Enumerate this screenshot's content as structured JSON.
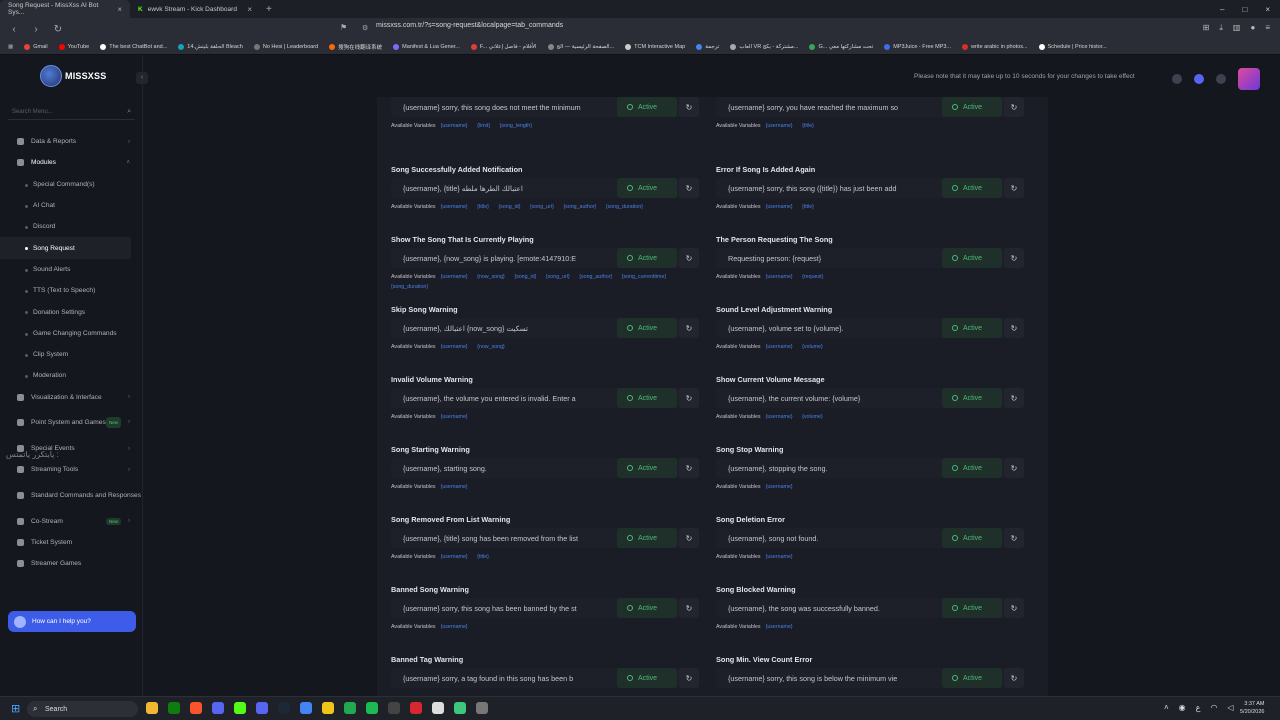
{
  "browser": {
    "tabs": [
      {
        "title": "Song Request - MissXss AI Bot Sys...",
        "active": true
      },
      {
        "title": "ewvk Stream - Kick Dashboard",
        "active": false
      }
    ],
    "url": "missxss.com.tr/?s=song-request&localpage=tab_commands",
    "bookmarks": [
      {
        "label": "Gmail",
        "color": "#ea4335"
      },
      {
        "label": "YouTube",
        "color": "#ff0000"
      },
      {
        "label": "The best ChatBot and...",
        "color": "#ffffff"
      },
      {
        "label": "14.الحلقة بليتش Bleach",
        "color": "#12a3b8"
      },
      {
        "label": "No Hesi | Leaderboard",
        "color": "#777777"
      },
      {
        "label": "搜狗在线翻译系统",
        "color": "#ff6a00"
      },
      {
        "label": "Manifest & Lua Gener...",
        "color": "#7b6cff"
      },
      {
        "label": "F... الأفلام - فاصل إعلاني",
        "color": "#e23b3b"
      },
      {
        "label": "الصفحة الرئيسية — الج...",
        "color": "#888888"
      },
      {
        "label": "TCM Interactive Map",
        "color": "#cccccc"
      },
      {
        "label": "ترجمة",
        "color": "#4285f4"
      },
      {
        "label": "العاب VR مشتركة - بكج...",
        "color": "#aaaaaa"
      },
      {
        "label": "G... تحت مشاركتها معي",
        "color": "#34a853"
      },
      {
        "label": "MP3Juice - Free MP3...",
        "color": "#3d6ee8"
      },
      {
        "label": "write arabic in photos...",
        "color": "#d93025"
      },
      {
        "label": "Schedule | Price histor...",
        "color": "#ffffff"
      }
    ]
  },
  "app": {
    "brand": "MISSXSS",
    "search_placeholder": "Search Menu...",
    "notice": "Please note that it may take up to 10 seconds for your changes to take effect",
    "help_button": "How can I help you?",
    "overlay_text": "يابتكرر ياتمتس :",
    "nav": [
      {
        "label": "Data & Reports",
        "kind": "top",
        "chevron": "›"
      },
      {
        "label": "Modules",
        "kind": "top",
        "chevron": "˄",
        "open": true
      },
      {
        "label": "Special Command(s)",
        "kind": "sub"
      },
      {
        "label": "AI Chat",
        "kind": "sub"
      },
      {
        "label": "Discord",
        "kind": "sub"
      },
      {
        "label": "Song Request",
        "kind": "sub",
        "active": true
      },
      {
        "label": "Sound Alerts",
        "kind": "sub"
      },
      {
        "label": "TTS (Text to Speech)",
        "kind": "sub"
      },
      {
        "label": "Donation Settings",
        "kind": "sub"
      },
      {
        "label": "Game Changing Commands",
        "kind": "sub"
      },
      {
        "label": "Clip System",
        "kind": "sub"
      },
      {
        "label": "Moderation",
        "kind": "sub"
      },
      {
        "label": "Visualization & Interface",
        "kind": "top",
        "chevron": "›"
      },
      {
        "label": "Point System and Games",
        "kind": "top",
        "chevron": "›",
        "badge": "New",
        "two": true
      },
      {
        "label": "Special Events",
        "kind": "top",
        "chevron": "›"
      },
      {
        "label": "Streaming Tools",
        "kind": "top",
        "chevron": "›"
      },
      {
        "label": "Standard Commands and Responses",
        "kind": "top",
        "chevron": "",
        "two": true
      },
      {
        "label": "Co-Stream",
        "kind": "top",
        "chevron": "›",
        "badge": "New"
      },
      {
        "label": "Ticket System",
        "kind": "top",
        "chevron": ""
      },
      {
        "label": "Streamer Games",
        "kind": "top",
        "chevron": ""
      }
    ]
  },
  "commands": {
    "status_label": "Active",
    "vars_label": "Available Variables",
    "left": [
      {
        "title": "",
        "text": "{username} sorry, this song does not meet the minimum",
        "vars": [
          "{username}",
          "{limit}",
          "{song_length}"
        ]
      },
      {
        "title": "Song Successfully Added Notification",
        "text": "{username}, {title} اعتبالك الطرها ملطه",
        "vars": [
          "{username}",
          "{title}",
          "{song_id}",
          "{song_url}",
          "{song_author}",
          "{song_duration}"
        ]
      },
      {
        "title": "Show The Song That Is Currently Playing",
        "text": "{username}, {now_song} is playing. [emote:4147910:E",
        "vars": [
          "{username}",
          "{now_song}",
          "{song_id}",
          "{song_url}",
          "{song_author}",
          "{song_currenttime}",
          "{song_duration}"
        ]
      },
      {
        "title": "Skip Song Warning",
        "text": "{username}, اعتبالك {now_song} تسكيت",
        "vars": [
          "{username}",
          "{now_song}"
        ]
      },
      {
        "title": "Invalid Volume Warning",
        "text": "{username}, the volume you entered is invalid. Enter a",
        "vars": [
          "{username}"
        ]
      },
      {
        "title": "Song Starting Warning",
        "text": "{username}, starting song.",
        "vars": [
          "{username}"
        ]
      },
      {
        "title": "Song Removed From List Warning",
        "text": "{username}, {title} song has been removed from the list",
        "vars": [
          "{username}",
          "{title}"
        ]
      },
      {
        "title": "Banned Song Warning",
        "text": "{username} sorry, this song has been banned by the st",
        "vars": [
          "{username}"
        ]
      },
      {
        "title": "Banned Tag Warning",
        "text": "{username} sorry, a tag found in this song has been b",
        "vars": []
      }
    ],
    "right": [
      {
        "title": "",
        "text": "{username} sorry, you have reached the maximum so",
        "vars": [
          "{username}",
          "{title}"
        ]
      },
      {
        "title": "Error If Song Is Added Again",
        "text": "{username} sorry, this song ({title}) has just been add",
        "vars": [
          "{username}",
          "{title}"
        ]
      },
      {
        "title": "The Person Requesting The Song",
        "text": "Requesting person: {request}",
        "vars": [
          "{username}",
          "{request}"
        ]
      },
      {
        "title": "Sound Level Adjustment Warning",
        "text": "{username}, volume set to {volume}.",
        "vars": [
          "{username}",
          "{volume}"
        ]
      },
      {
        "title": "Show Current Volume Message",
        "text": "{username}, the current volume: {volume}",
        "vars": [
          "{username}",
          "{volume}"
        ]
      },
      {
        "title": "Song Stop Warning",
        "text": "{username}, stopping the song.",
        "vars": [
          "{username}"
        ]
      },
      {
        "title": "Song Deletion Error",
        "text": "{username}, song not found.",
        "vars": [
          "{username}"
        ]
      },
      {
        "title": "Song Blocked Warning",
        "text": "{username}, the song was successfully banned.",
        "vars": [
          "{username}"
        ]
      },
      {
        "title": "Song Min. View Count Error",
        "text": "{username} sorry, this song is below the minimum vie",
        "vars": []
      }
    ]
  },
  "taskbar": {
    "search": "Search",
    "time": "3:37 AM",
    "date": "5/20/2026"
  }
}
